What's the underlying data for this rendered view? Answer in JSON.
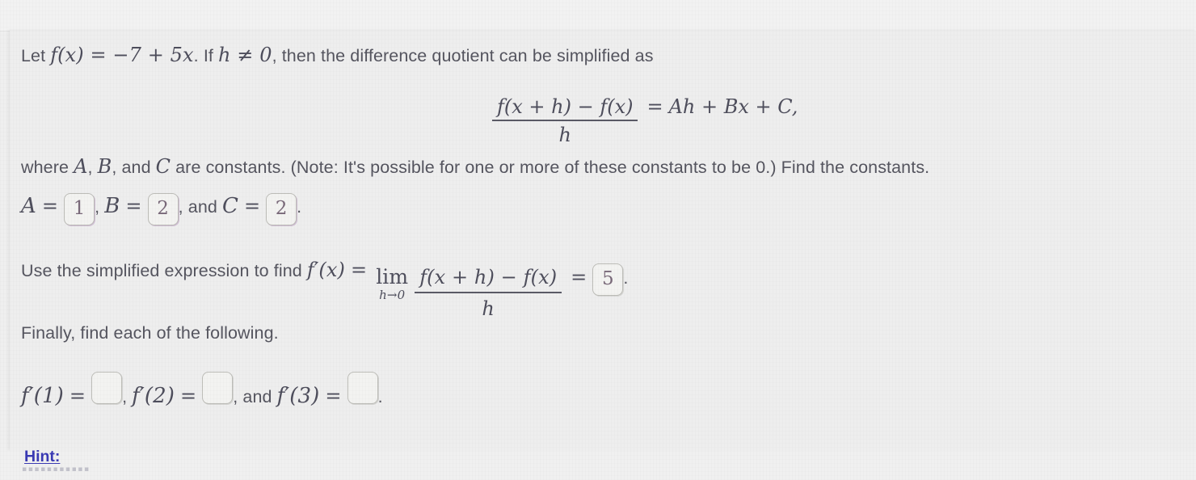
{
  "problem": {
    "intro": {
      "lead": "Let",
      "function_def": "f(x) = −7 + 5x",
      "condition_prefix": ". If",
      "condition": "h ≠ 0",
      "tail": ", then the difference quotient can be simplified as"
    },
    "display_equation": {
      "numerator": "f(x + h) − f(x)",
      "denominator": "h",
      "equals": "=",
      "right_side": "Ah + Bx + C,"
    },
    "constants_note": {
      "prefix": "where",
      "var_a": "A",
      "comma1": ",",
      "var_b": "B",
      "conj": ", and",
      "var_c": "C",
      "text": "are constants. (Note: It's possible for one or more of these constants to be 0.) Find the constants."
    },
    "answers_line": {
      "label_a": "A",
      "value_a": "1",
      "sep1": ",",
      "label_b": "B",
      "value_b": "2",
      "conj": ", and",
      "label_c": "C",
      "value_c": "2",
      "period": "."
    },
    "derivative_line": {
      "text": "Use the simplified expression to find",
      "fprime": "f′(x)",
      "equals1": "=",
      "lim_op": "lim",
      "lim_sub": "h→0",
      "numerator": "f(x + h) − f(x)",
      "denominator": "h",
      "equals2": "=",
      "value": "5",
      "period": "."
    },
    "finally_text": "Finally, find each of the following.",
    "values_line": {
      "label_1": "f′(1)",
      "equals_1": "=",
      "value_1": "",
      "sep_1": ",",
      "label_2": "f′(2)",
      "equals_2": "=",
      "value_2": "",
      "conj": ", and",
      "label_3": "f′(3)",
      "equals_3": "=",
      "value_3": "",
      "period": "."
    },
    "hint": {
      "label": "Hint:",
      "subtext": "▪▪▪▪▪▪▪▪▪▪▪"
    }
  },
  "colors": {
    "text": "#55555f",
    "math": "#4e4e5c",
    "link": "#3a3ab4",
    "box_border": "#bdbdb8",
    "box_accent": "#aa82b4",
    "background": "#efefef"
  }
}
